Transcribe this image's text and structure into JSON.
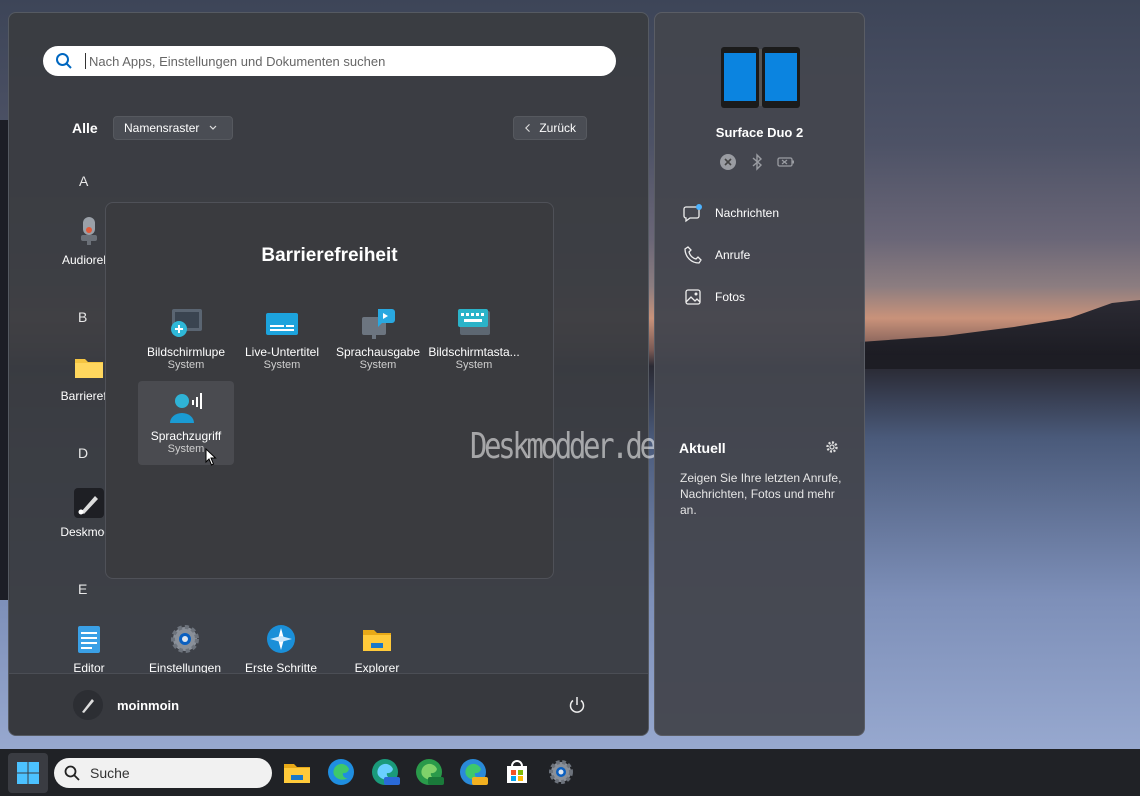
{
  "start_menu": {
    "search_placeholder": "Nach Apps, Einstellungen und Dokumenten suchen",
    "all_label": "Alle",
    "view_button": "Namensraster",
    "back_button": "Zurück",
    "letters": [
      "A",
      "B",
      "D",
      "E"
    ],
    "left_apps": {
      "audio": "Audioreko",
      "barriere": "Barrierefre",
      "deskmodder": "Deskmodd"
    },
    "bottom_apps": [
      "Editor",
      "Einstellungen",
      "Erste Schritte",
      "Explorer"
    ],
    "user_name": "moinmoin"
  },
  "folder": {
    "title": "Barrierefreiheit",
    "apps": [
      {
        "name": "Bildschirmlupe",
        "sub": "System"
      },
      {
        "name": "Live-Untertitel",
        "sub": "System"
      },
      {
        "name": "Sprachausgabe",
        "sub": "System"
      },
      {
        "name": "Bildschirmtasta...",
        "sub": "System"
      },
      {
        "name": "Sprachzugriff",
        "sub": "System"
      }
    ]
  },
  "watermark": "Deskmodder.de",
  "phone": {
    "device_name": "Surface Duo 2",
    "items": [
      "Nachrichten",
      "Anrufe",
      "Fotos"
    ],
    "aktuell_title": "Aktuell",
    "aktuell_desc": "Zeigen Sie Ihre letzten Anrufe, Nachrichten, Fotos und mehr an."
  },
  "taskbar": {
    "search_label": "Suche"
  },
  "colors": {
    "accent": "#0078d4",
    "folder_yellow": "#f4c542"
  }
}
